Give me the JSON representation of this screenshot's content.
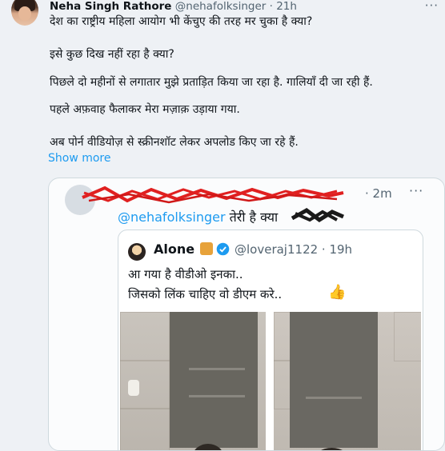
{
  "author": {
    "name": "Neha Singh Rathore",
    "handle": "@nehafolksinger",
    "time": "21h"
  },
  "tweet": {
    "lines": [
      "देश का राष्ट्रीय महिला आयोग भी केंचुए की तरह मर चुका है क्या?",
      "इसे कुछ दिख नहीं रहा है क्या?",
      "पिछले दो महीनों से लगातार मुझे प्रताड़ित किया जा रहा है. गालियाँ दी जा रही हैं.",
      "पहले अफ़वाह फैलाकर मेरा मज़ाक़ उड़ाया गया.",
      "अब पोर्न वीडियोज़ से स्क्रीनशॉट लेकर अपलोड किए जा रहे हैं."
    ],
    "show_more": "Show more"
  },
  "card": {
    "time": "2m",
    "mention": "@nehafolksinger",
    "text_after_mention": "तेरी है क्या",
    "quoted": {
      "name": "Alone",
      "handle": "@loveraj1122",
      "time": "19h",
      "line1": "आ गया है वीडीओ इनका..",
      "line2": "जिसको लिंक चाहिए वो डीएम करे..",
      "emoji": "👍"
    }
  },
  "icons": {
    "more": "more-horizontal-icon",
    "verified": "verified-badge-icon",
    "tiger": "tiger-emoji-icon"
  },
  "colors": {
    "accent": "#1d9bf0",
    "secondary_text": "#536471",
    "scribble": "#e02020"
  }
}
